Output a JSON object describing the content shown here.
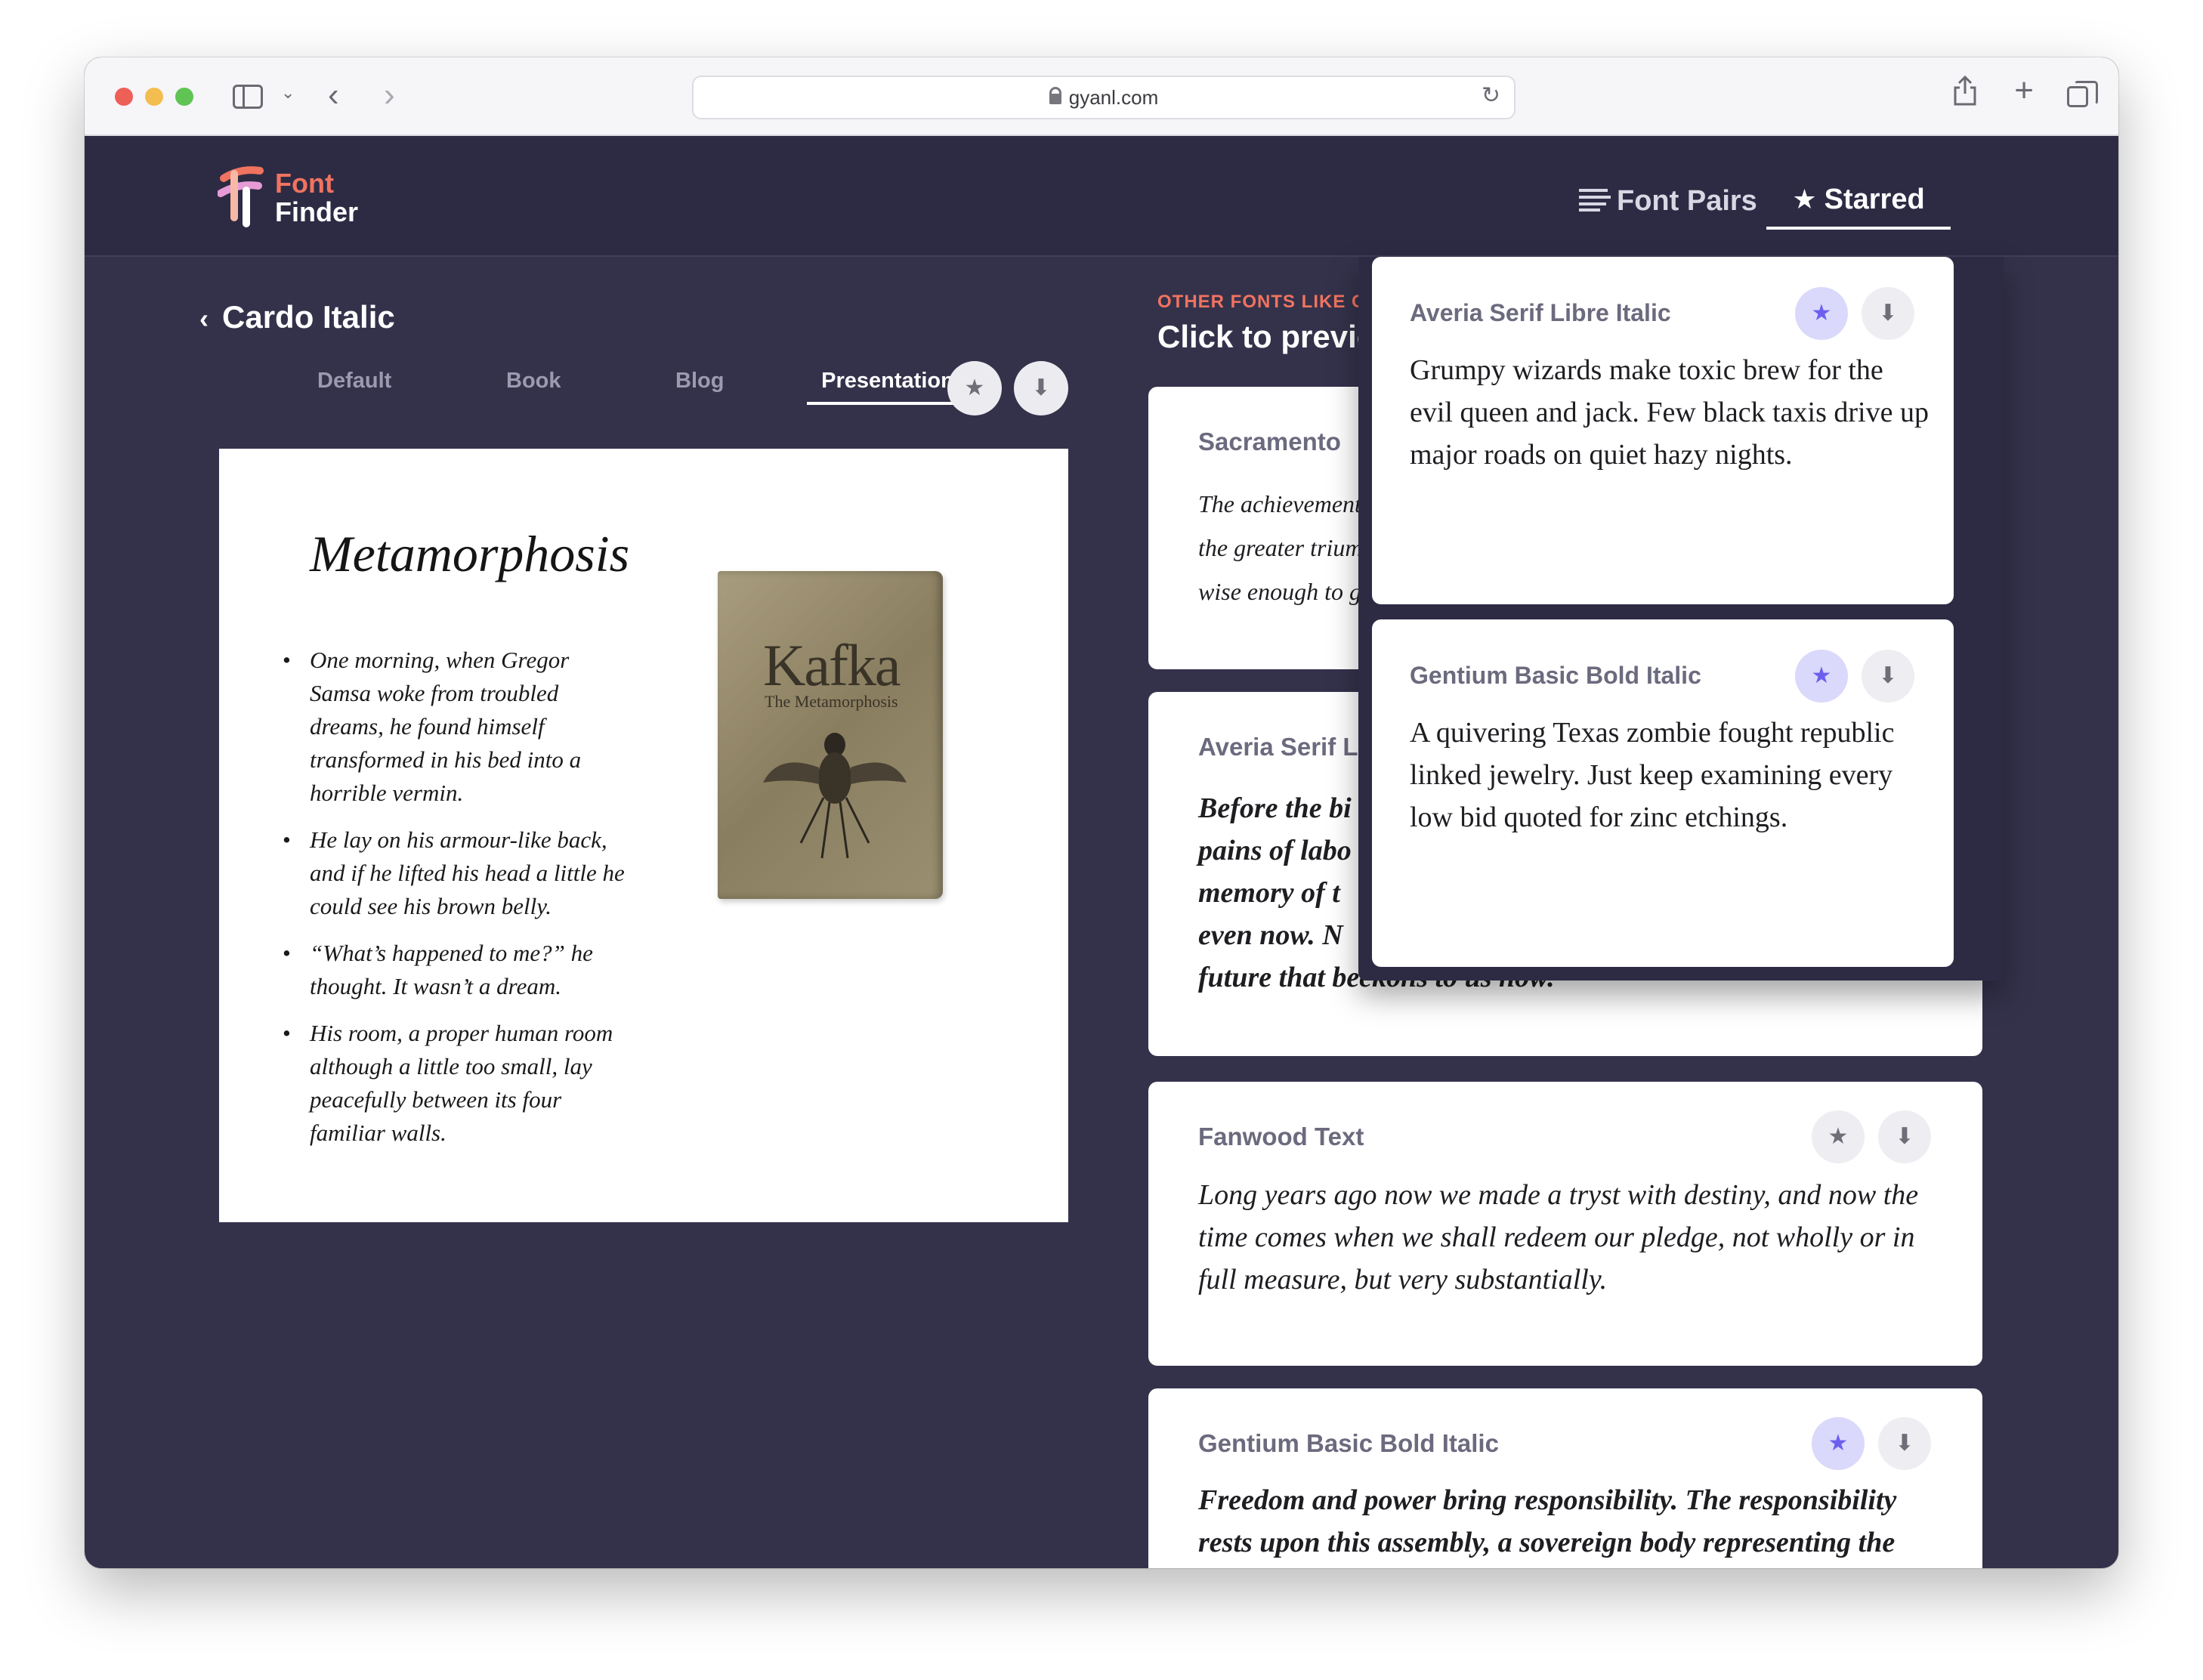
{
  "browser": {
    "url": "gyanl.com"
  },
  "app": {
    "logo_line1": "Font",
    "logo_line2": "Finder",
    "nav_font_pairs": "Font Pairs",
    "nav_starred": "Starred"
  },
  "detail": {
    "back_label": "Cardo Italic",
    "tabs": [
      "Default",
      "Book",
      "Blog",
      "Presentation"
    ],
    "active_tab": "Presentation",
    "preview": {
      "title": "Metamorphosis",
      "bullets": [
        "One morning, when Gregor Samsa woke from troubled dreams, he found himself transformed in his bed into a horrible vermin.",
        "He lay on his armour-like back, and if he lifted his head a little he could see his brown belly.",
        "“What’s happened to me?” he thought. It wasn’t a dream.",
        "His room, a proper human room although a little too small, lay peacefully between its four familiar walls."
      ],
      "book_author": "Kafka",
      "book_subtitle": "The Metamorphosis"
    }
  },
  "similar": {
    "kicker": "OTHER FONTS LIKE CA",
    "title": "Click to previe",
    "cards": [
      {
        "name": "Sacramento",
        "sample": "The achievement\nthe greater triump\nwise enough to gra",
        "starred": false
      },
      {
        "name": "Averia Serif Li",
        "sample": "Before the bi\npains of labo\nmemory of t\neven now. N\nfuture that beckons to us now.",
        "starred": false
      },
      {
        "name": "Fanwood Text",
        "sample": "Long years ago now we made a tryst with destiny, and now the time comes when we shall redeem our pledge, not wholly or in full measure, but very substantially.",
        "starred": false
      },
      {
        "name": "Gentium Basic Bold Italic",
        "sample": "Freedom and power bring responsibility. The responsibility rests upon this assembly, a sovereign body representing the",
        "starred": true
      }
    ]
  },
  "starred_dropdown": {
    "items": [
      {
        "name": "Averia Serif Libre Italic",
        "sample": "Grumpy wizards make toxic brew for the evil queen and jack. Few black taxis drive up major roads on quiet hazy nights.",
        "starred": true
      },
      {
        "name": "Gentium Basic Bold Italic",
        "sample": "A quivering Texas zombie fought republic linked jewelry. Just keep examining every low bid quoted for zinc etchings.",
        "starred": true
      }
    ]
  },
  "icons": {
    "star": "★",
    "download": "⬇",
    "back_chevron": "‹"
  },
  "colors": {
    "accent": "#f0735f",
    "star_active": "#6c5ff0",
    "header_bg": "#2d2b44",
    "page_bg": "#34324b"
  }
}
